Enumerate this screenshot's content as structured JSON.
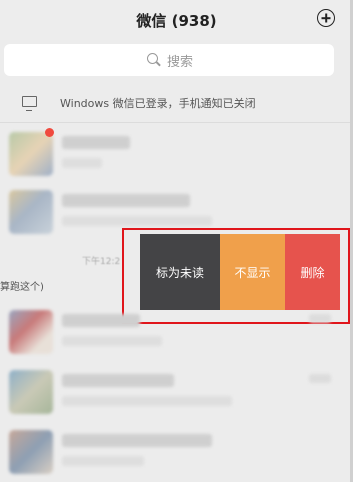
{
  "header": {
    "title": "微信 (938)",
    "add_icon": "plus-circle-icon"
  },
  "search": {
    "placeholder": "搜索",
    "icon": "search-icon"
  },
  "pc_status": {
    "icon": "monitor-icon",
    "text": "Windows 微信已登录，手机通知已关闭"
  },
  "chats": [
    {
      "unread": true
    },
    {
      "unread": false
    },
    {
      "unread": false
    },
    {
      "unread": false
    },
    {
      "unread": false
    }
  ],
  "swiped_row": {
    "partial_preview": "算跑这个)",
    "partial_time": "下午12:2",
    "actions": {
      "mark_unread": "标为未读",
      "hide": "不显示",
      "delete": "删除"
    },
    "highlight_color": "#e0151b"
  },
  "colors": {
    "mark_unread_bg": "#444446",
    "hide_bg": "#f0a04b",
    "delete_bg": "#e6534d",
    "badge": "#f04a3e"
  }
}
